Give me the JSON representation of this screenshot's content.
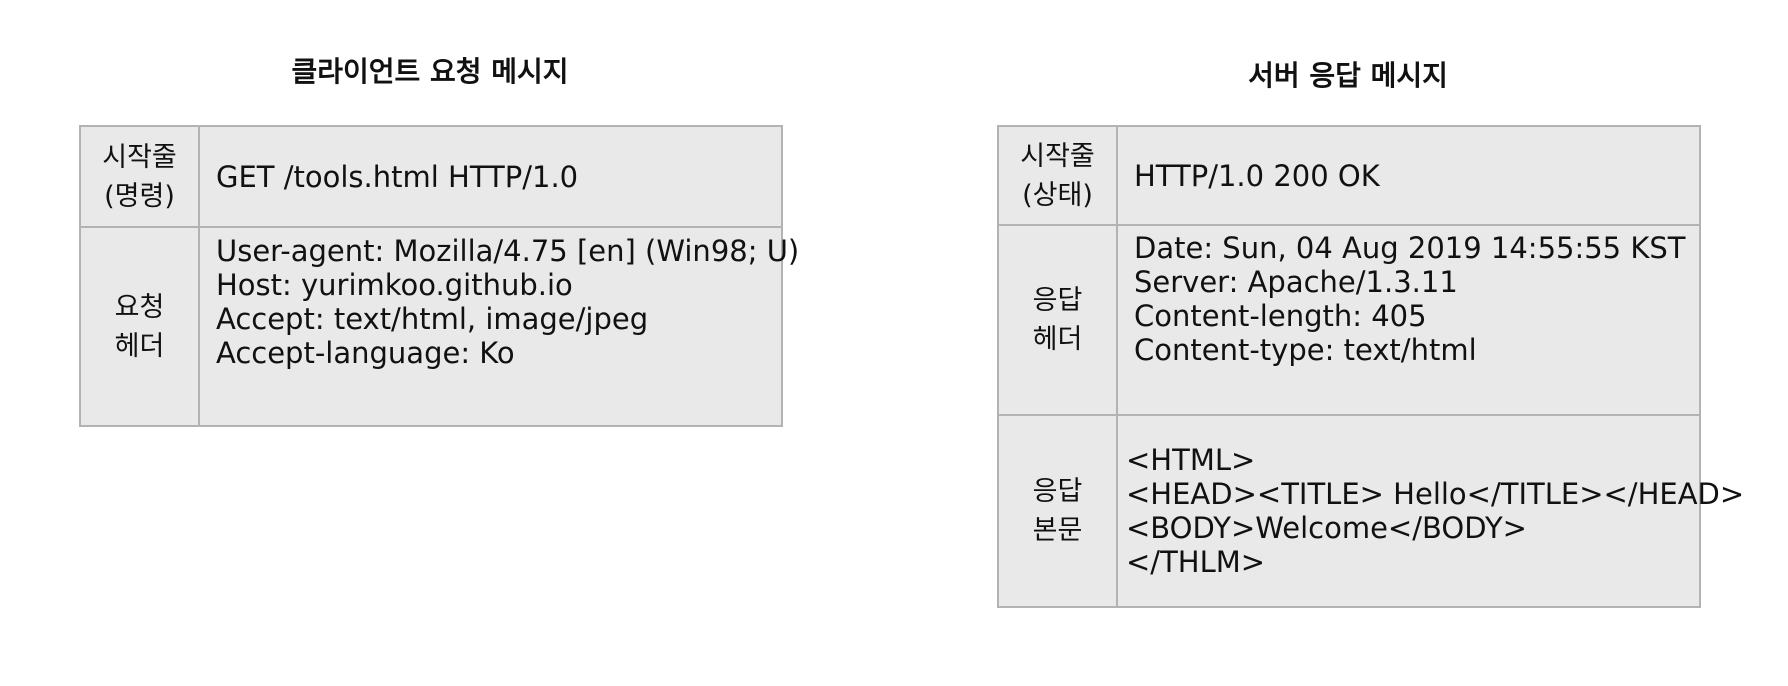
{
  "client": {
    "title": "클라이언트 요청 메시지",
    "start_line_label": [
      "시작줄",
      "(명령)"
    ],
    "start_line": "GET /tools.html HTTP/1.0",
    "header_label": [
      "요청",
      "헤더"
    ],
    "headers": [
      "User-agent: Mozilla/4.75 [en] (Win98; U)",
      "Host: yurimkoo.github.io",
      "Accept: text/html, image/jpeg",
      "Accept-language: Ko"
    ]
  },
  "server": {
    "title": "서버 응답 메시지",
    "start_line_label": [
      "시작줄",
      "(상태)"
    ],
    "start_line": "HTTP/1.0 200 OK",
    "header_label": [
      "응답",
      "헤더"
    ],
    "headers": [
      "Date: Sun, 04 Aug 2019 14:55:55 KST",
      "Server: Apache/1.3.11",
      "Content-length: 405",
      "Content-type: text/html"
    ],
    "body_label": [
      "응답",
      "본문"
    ],
    "body": [
      "<HTML>",
      "<HEAD><TITLE> Hello</TITLE></HEAD>",
      "<BODY>Welcome</BODY>",
      "</THLM>"
    ]
  }
}
